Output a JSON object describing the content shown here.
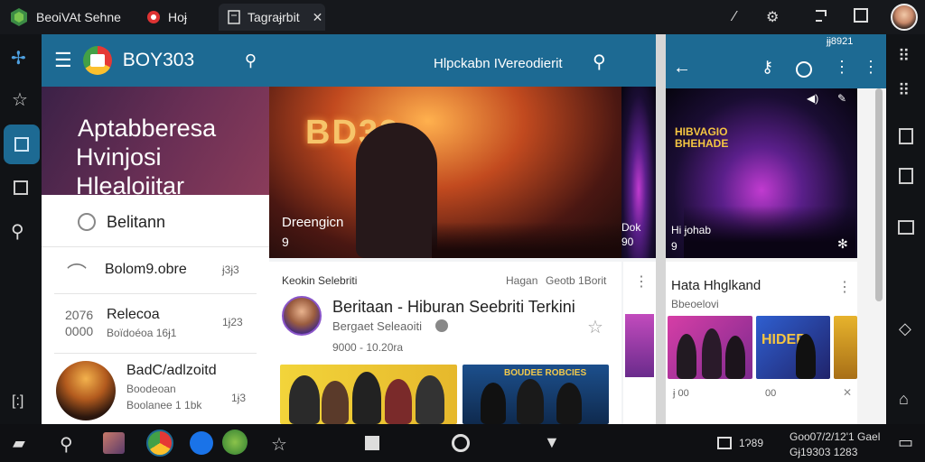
{
  "browser": {
    "tab1_title": "BeoiVAt Sehne",
    "tab2_title": "Hoɉ",
    "tab3_title": "Tagraɉrbit",
    "avatar_alt": "user"
  },
  "left_panel": {
    "brand": "BOY303",
    "hero_line1": "Aptabberesa",
    "hero_line2": "Hvinjosi Hlealoiitar",
    "items": [
      {
        "label": "Belitann",
        "meta": ""
      },
      {
        "label": "Bolom9.obre",
        "meta": "ɉ3ɉ3"
      },
      {
        "left": "2076\n0000",
        "label": "Relecoa",
        "sub": "Boïdoéoa 16ɉ1",
        "meta": "1ɉ23"
      },
      {
        "label": "BadC/adlzoitd",
        "sub": "Boodeoan",
        "sub2": "Boolanee 1 1bk",
        "meta": "1ɉ3"
      }
    ]
  },
  "center_panel": {
    "header_title": "Hlpckabn IVereodierit",
    "hero_logo": "BD39",
    "hero_caption": "Dreengicn",
    "hero_num": "9",
    "section_label": "Keokin Selebriti",
    "section_links": [
      "Hagan",
      "Geotb 1Borit"
    ],
    "article_title": "Beritaan - Hiburan Seebriti Terkini",
    "article_sub": "Bergaet Seleaoiti",
    "article_meta": "9000 - 10.20ra",
    "thumb2_text": "BOUDEE ROBCIES"
  },
  "right_panel": {
    "status": "ɉɉ8921",
    "stage_logo": "HIBVAGIO BHEHADE",
    "stage_caption": "Hi ɉohab",
    "stage_num": "9",
    "side_caption": "Dok\n90",
    "section_title": "Hata Hhglkand",
    "section_sub": "Bbeoelovi",
    "thumb_logo": "HIDER",
    "counts": [
      "ɉ 00",
      "00"
    ]
  },
  "taskbar": {
    "tray_text": "1Ɂ89 ",
    "clock_line1": "Goo07/2/12'1 Gael",
    "clock_line2": "Gɉ19303  1283"
  },
  "colors": {
    "header_blue": "#1d6a93",
    "accent_purple": "#6a2f55"
  }
}
